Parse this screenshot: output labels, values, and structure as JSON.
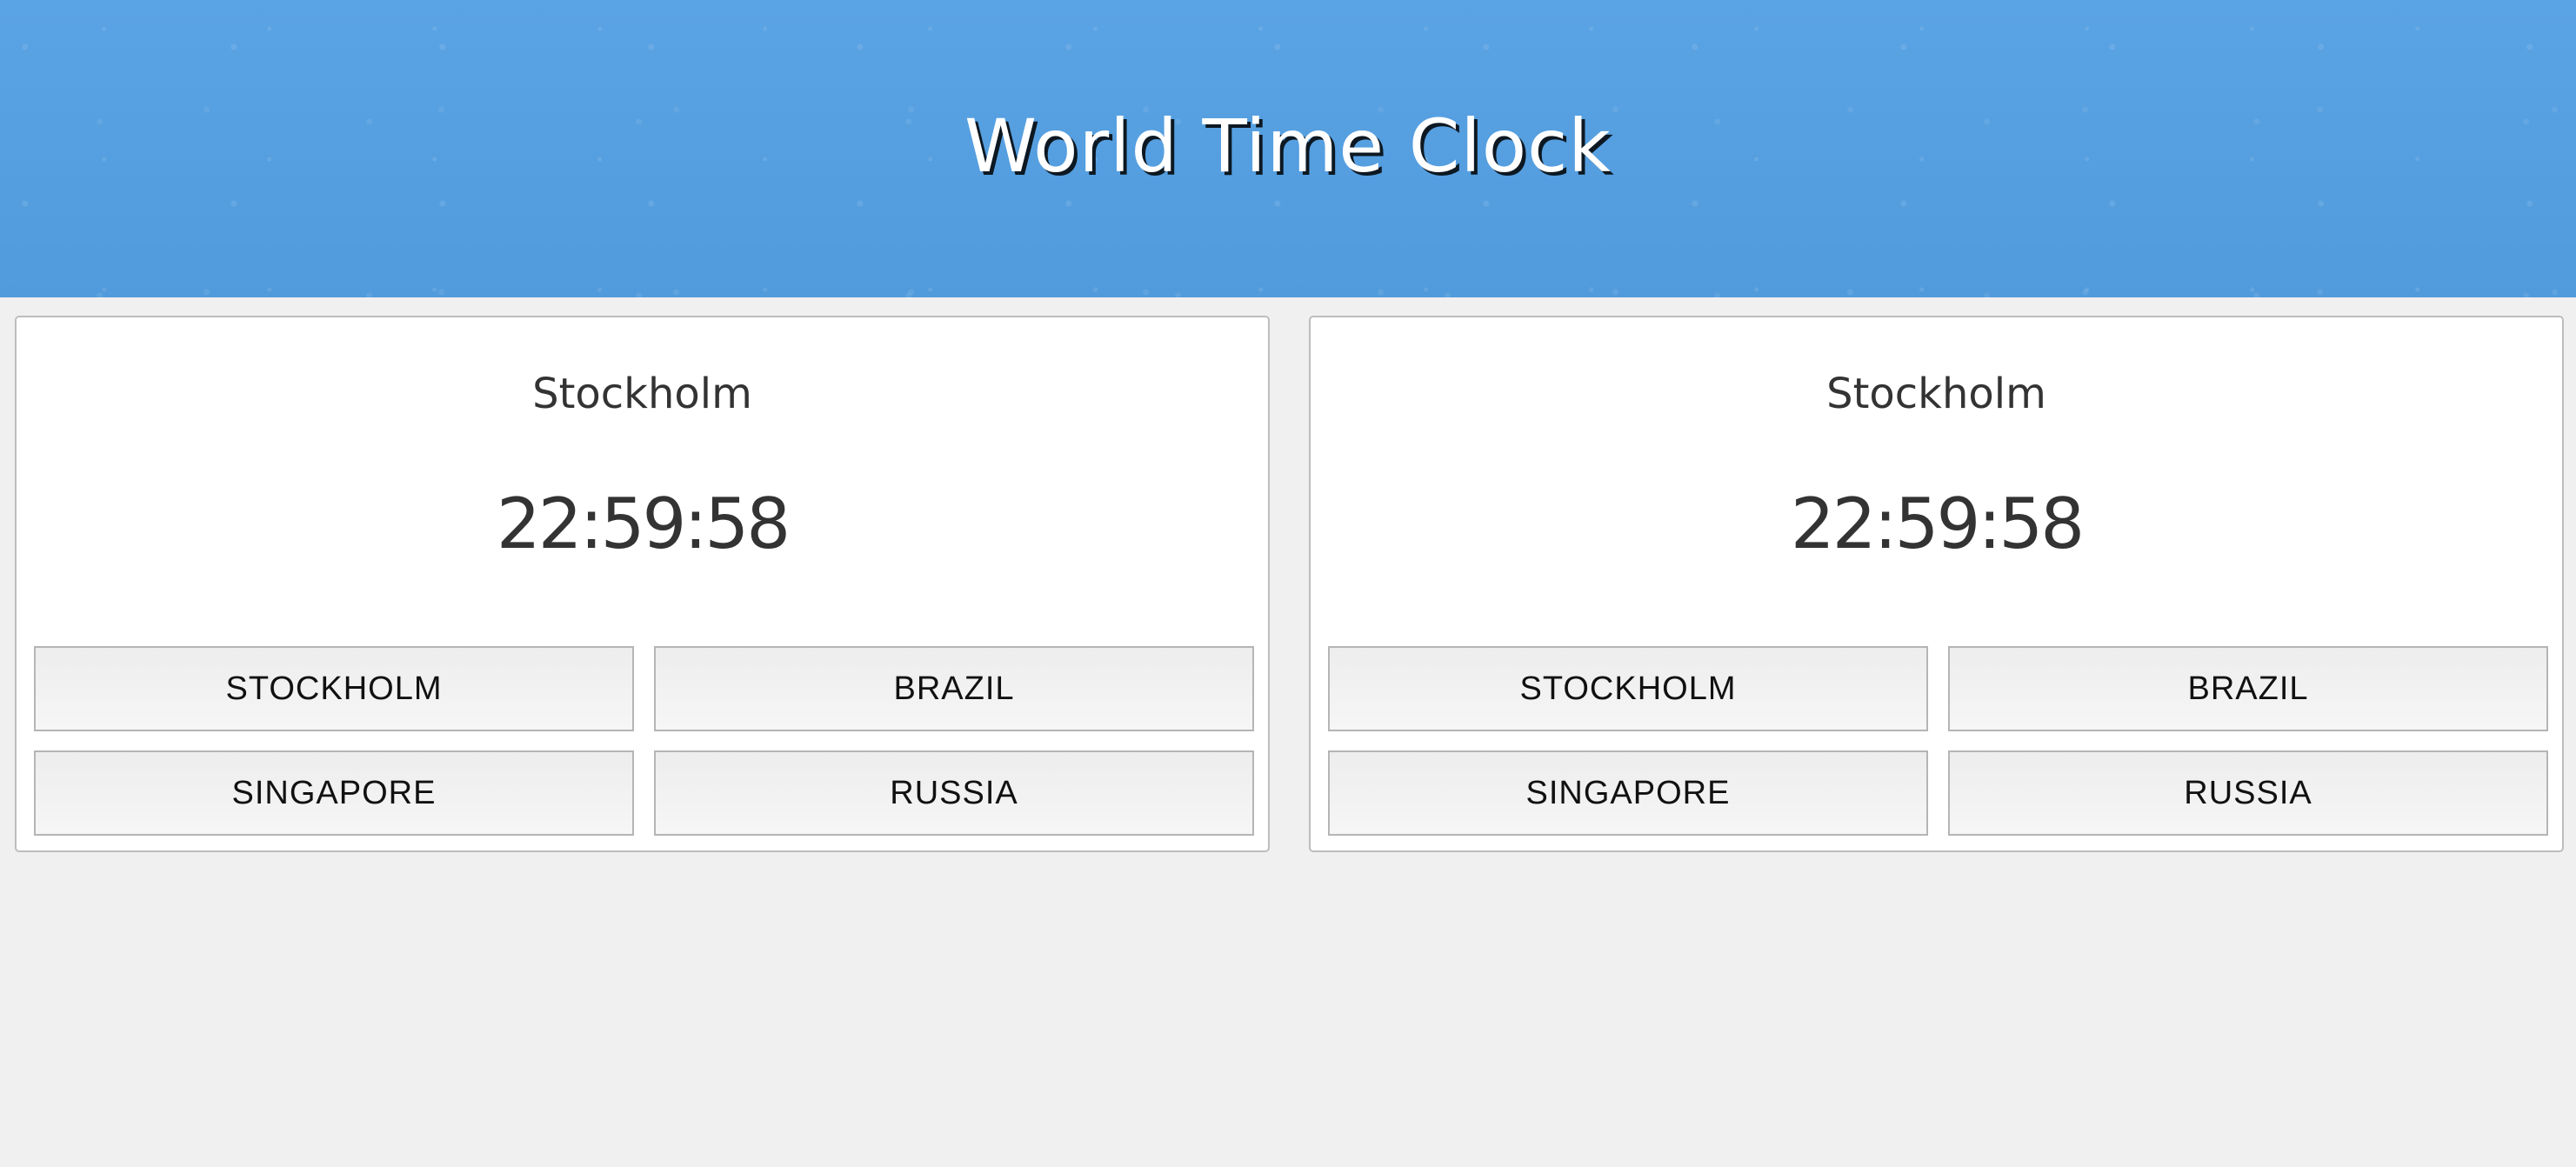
{
  "header": {
    "title": "World Time Clock",
    "background_color": "#58a1e2"
  },
  "clocks": [
    {
      "city": "Stockholm",
      "time": "22:59:58",
      "buttons": [
        "STOCKHOLM",
        "BRAZIL",
        "SINGAPORE",
        "RUSSIA"
      ]
    },
    {
      "city": "Stockholm",
      "time": "22:59:58",
      "buttons": [
        "STOCKHOLM",
        "BRAZIL",
        "SINGAPORE",
        "RUSSIA"
      ]
    }
  ]
}
